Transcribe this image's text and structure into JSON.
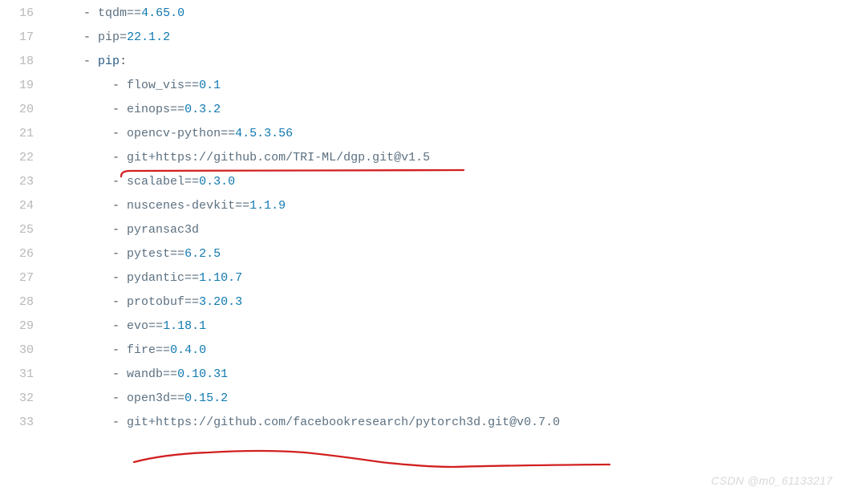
{
  "lines": [
    {
      "num": "16",
      "indent1": "",
      "text": "tqdm==4.65.0",
      "numval": "4.65.0"
    },
    {
      "num": "17",
      "indent1": "",
      "text": "pip=22.1.2",
      "numval": "22.1.2"
    },
    {
      "num": "18",
      "indent1": "",
      "key": "pip",
      "colon": ":"
    },
    {
      "num": "19",
      "indent2": "",
      "text": "flow_vis==0.1",
      "numval": "0.1"
    },
    {
      "num": "20",
      "indent2": "",
      "text": "einops==0.3.2",
      "numval": "0.3.2"
    },
    {
      "num": "21",
      "indent2": "",
      "text": "opencv-python==4.5.3.56",
      "numval": "4.5.3.56"
    },
    {
      "num": "22",
      "indent2": "",
      "text": "git+https://github.com/TRI-ML/dgp.git@v1.5"
    },
    {
      "num": "23",
      "indent2": "",
      "text": "scalabel==0.3.0",
      "numval": "0.3.0"
    },
    {
      "num": "24",
      "indent2": "",
      "text": "nuscenes-devkit==1.1.9",
      "numval": "1.1.9"
    },
    {
      "num": "25",
      "indent2": "",
      "text": "pyransac3d"
    },
    {
      "num": "26",
      "indent2": "",
      "text": "pytest==6.2.5",
      "numval": "6.2.5"
    },
    {
      "num": "27",
      "indent2": "",
      "text": "pydantic==1.10.7",
      "numval": "1.10.7"
    },
    {
      "num": "28",
      "indent2": "",
      "text": "protobuf==3.20.3",
      "numval": "3.20.3"
    },
    {
      "num": "29",
      "indent2": "",
      "text": "evo==1.18.1",
      "numval": "1.18.1"
    },
    {
      "num": "30",
      "indent2": "",
      "text": "fire==0.4.0",
      "numval": "0.4.0"
    },
    {
      "num": "31",
      "indent2": "",
      "text": "wandb==0.10.31",
      "numval": "0.10.31"
    },
    {
      "num": "32",
      "indent2": "",
      "text": "open3d==0.15.2",
      "numval": "0.15.2"
    },
    {
      "num": "33",
      "indent2": "",
      "text": "git+https://github.com/facebookresearch/pytorch3d.git@v0.7.0"
    }
  ],
  "watermark": "CSDN @m0_61133217"
}
